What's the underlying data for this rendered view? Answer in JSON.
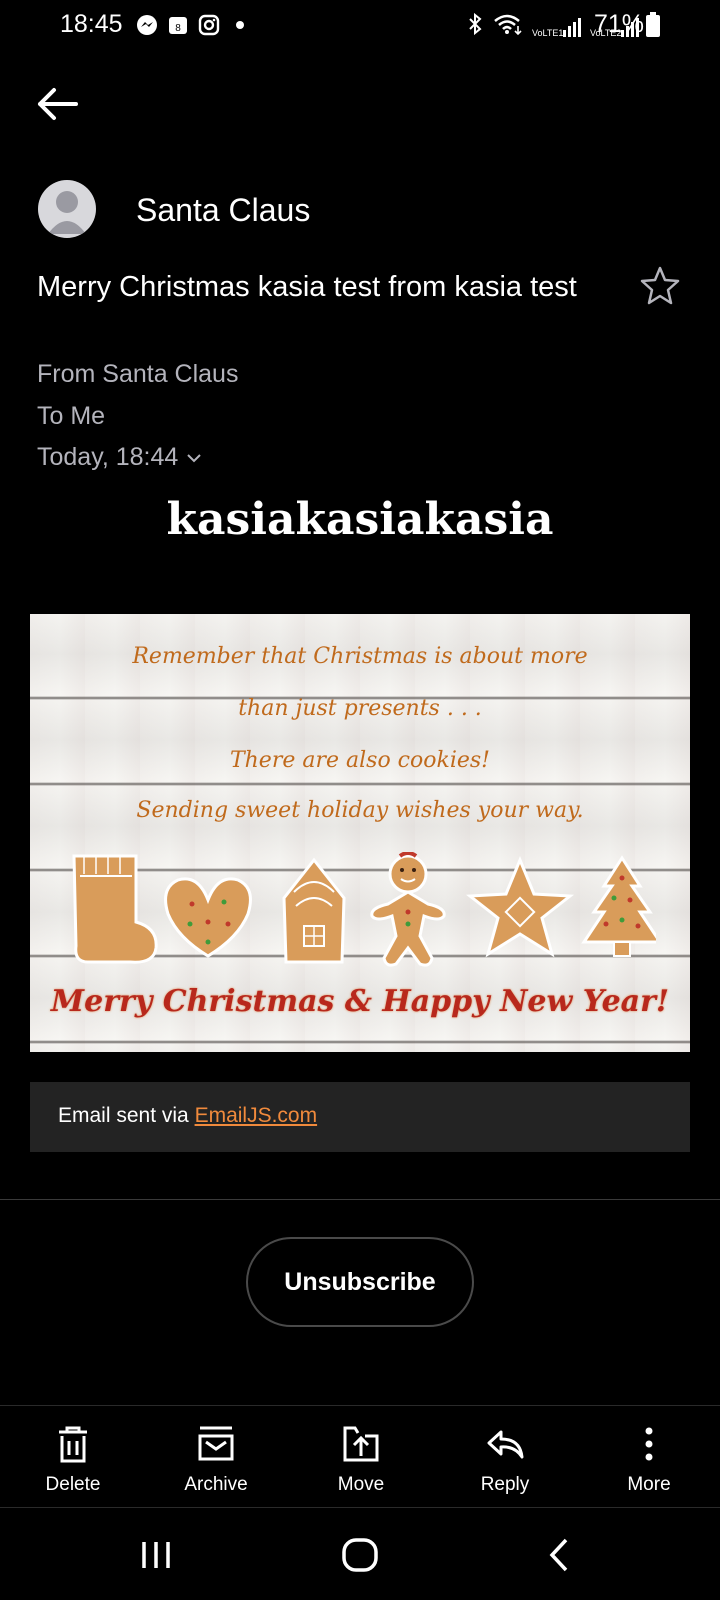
{
  "status_bar": {
    "time": "18:45",
    "battery": "71%",
    "left_icons": [
      "messenger-icon",
      "calendar-icon",
      "instagram-icon",
      "dot-icon"
    ],
    "right_icons": [
      "bluetooth-icon",
      "wifi-icon",
      "signal-lte1-icon",
      "signal-lte2-icon",
      "battery-icon"
    ],
    "sim1_label": "VoLTE1",
    "sim2_label": "VoLTE2",
    "calendar_day": "8"
  },
  "header": {
    "back_icon": "arrow-left-icon"
  },
  "message": {
    "sender_name": "Santa Claus",
    "subject": "Merry Christmas kasia test from kasia test",
    "from_line": "From Santa Claus",
    "to_line": "To Me",
    "date_line": "Today, 18:44",
    "starred": false
  },
  "body": {
    "heading": "kasiakasiakasia",
    "card": {
      "line1": "Remember that Christmas is about more",
      "line2": "than just presents . . .",
      "line3": "There are also cookies!",
      "line4": "Sending sweet holiday wishes your way.",
      "footer_line": "Merry Christmas & Happy New Year!",
      "cookies": [
        "stocking",
        "heart",
        "house",
        "gingerbread-man",
        "star",
        "tree"
      ]
    },
    "sent_via_prefix": "Email sent via ",
    "sent_via_link": "EmailJS.com"
  },
  "unsubscribe_label": "Unsubscribe",
  "toolbar": {
    "items": [
      {
        "label": "Delete",
        "icon": "trash-icon"
      },
      {
        "label": "Archive",
        "icon": "archive-icon"
      },
      {
        "label": "Move",
        "icon": "move-icon"
      },
      {
        "label": "Reply",
        "icon": "reply-icon"
      },
      {
        "label": "More",
        "icon": "more-vertical-icon"
      }
    ]
  },
  "colors": {
    "background": "#000000",
    "meta_text": "#b4b4bc",
    "link": "#f08a3c",
    "card_text": "#c06a1c",
    "card_footer": "#b8281c",
    "footer_box": "#232323"
  }
}
